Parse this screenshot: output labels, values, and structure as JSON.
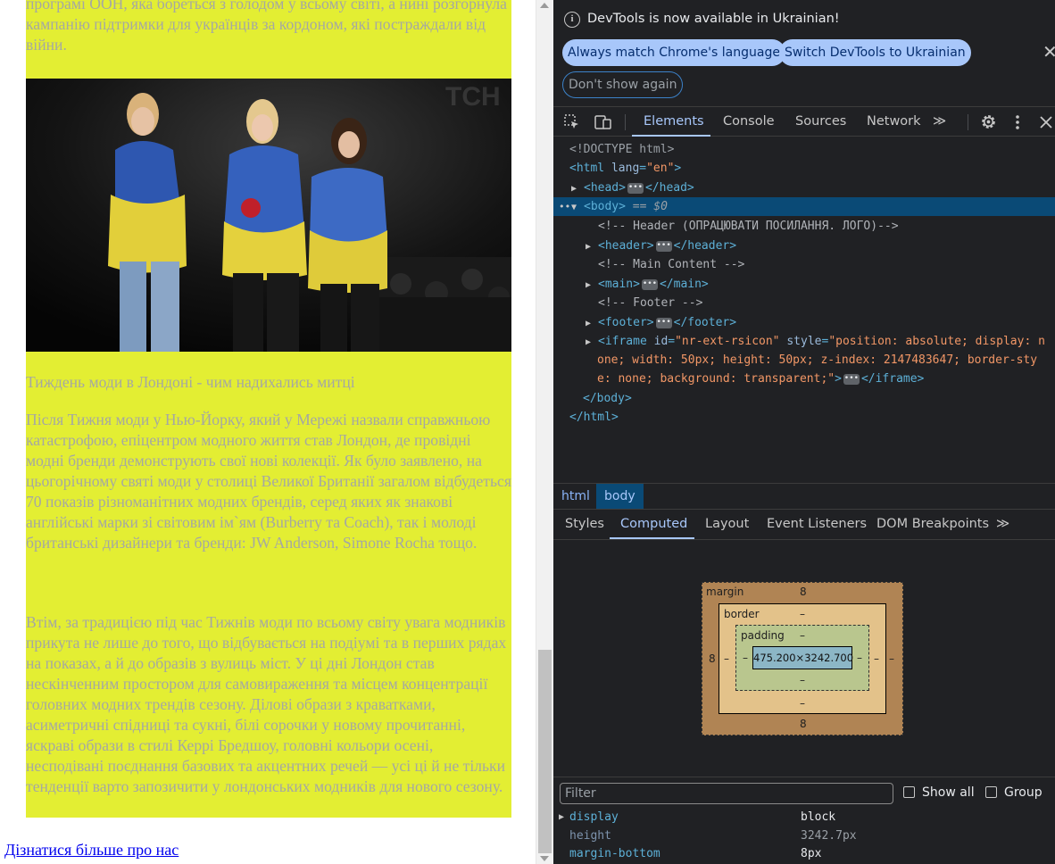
{
  "page": {
    "intro_text": "програмі ООН, яка бореться з голодом у всьому світі, а нині розгорнула кампанію підтримки для українців за кордоном, які постраждали від війни.",
    "photo_watermark": "ТСН",
    "article_title": "Тиждень моди в Лондоні - чим надихались митці",
    "paragraph1": "Після Тижня моди у Нью-Йорку, який у Мережі назвали справжньою катастрофою, епіцентром модного життя став Лондон, де провідні модні бренди демонструють свої нові колекції. Як було заявлено, на цьогорічному святі моди у столиці Великої Британії загалом відбудеться 70 показів різноманітних модних брендів, серед яких як знакові англійські марки зі світовим ім`ям (Burberry та Coach), так і молоді британські дизайнери та бренди: JW Anderson, Simone Rocha тощо.",
    "paragraph2": "Втім, за традицією під час Тижнів моди по всьому світу увага модників прикута не лише до того, що відбувається на подіумі та в перших рядах на показах, а й до образів з вулиць міст. У ці дні Лондон став нескінченним простором для самовираження та місцем концентрації головних модних трендів сезону. Ділові образи з краватками, асиметричні спідниці та сукні, білі сорочки у новому прочитанні, яскраві образи в стилі Керрі Бредшоу, головні кольори осені, несподівані поєднання базових та акцентних речей — усі ці й не тільки тенденції варто запозичити у лондонських модників для нового сезону.",
    "learn_more_link": "Дізнатися більше про нас",
    "content_bg": "#e3ee33",
    "text_color": "#a5a8a2"
  },
  "devtools": {
    "infobar": {
      "message": "DevTools is now available in Ukrainian!",
      "btn_match": "Always match Chrome's language",
      "btn_switch": "Switch DevTools to Ukrainian",
      "btn_dont": "Don't show again",
      "close": "✕"
    },
    "tabs": [
      "Elements",
      "Console",
      "Sources",
      "Network"
    ],
    "more_tabs": "≫",
    "dom": {
      "doctype": "<!DOCTYPE html>",
      "html_open": "<html",
      "html_lang_attr": "lang",
      "html_lang_val": "\"en\"",
      "head": "<head>",
      "head_close": "</head>",
      "body": "<body>",
      "body_eq": "== $0",
      "comment_header": "<!-- Header (ОПРАЦЮВАТИ ПОСИЛАННЯ. ЛОГО)-->",
      "header": "<header>",
      "header_close": "</header>",
      "comment_main": "<!-- Main Content -->",
      "main": "<main>",
      "main_close": "</main>",
      "comment_footer": "<!-- Footer -->",
      "footer": "<footer>",
      "footer_close": "</footer>",
      "iframe_open": "<iframe",
      "iframe_id_attr": "id",
      "iframe_id_val": "\"nr-ext-rsicon\"",
      "iframe_style_attr": "style",
      "iframe_style_val_1": "\"position: absolute; display: n",
      "iframe_style_val_2": "one; width: 50px; height: 50px; z-index: 2147483647; border-sty",
      "iframe_style_val_3": "e: none; background: transparent;\"",
      "iframe_close": "</iframe>",
      "body_close": "</body>",
      "html_close": "</html>"
    },
    "breadcrumbs": [
      "html",
      "body"
    ],
    "subtabs": [
      "Styles",
      "Computed",
      "Layout",
      "Event Listeners",
      "DOM Breakpoints"
    ],
    "box_model": {
      "margin_label": "margin",
      "margin_top": "8",
      "margin_bottom": "8",
      "margin_left": "8",
      "margin_right": "–",
      "border_label": "border",
      "border_top": "–",
      "border_bottom": "–",
      "border_left": "–",
      "border_right": "–",
      "padding_label": "padding",
      "padding_top": "–",
      "padding_bottom": "–",
      "padding_left": "–",
      "padding_right": "–",
      "content": "475.200×3242.700"
    },
    "filter_placeholder": "Filter",
    "show_all": "Show all",
    "group": "Group",
    "properties": [
      {
        "name": "display",
        "value": "block"
      },
      {
        "name": "height",
        "value": "3242.7px"
      },
      {
        "name": "margin-bottom",
        "value": "8px"
      }
    ]
  }
}
